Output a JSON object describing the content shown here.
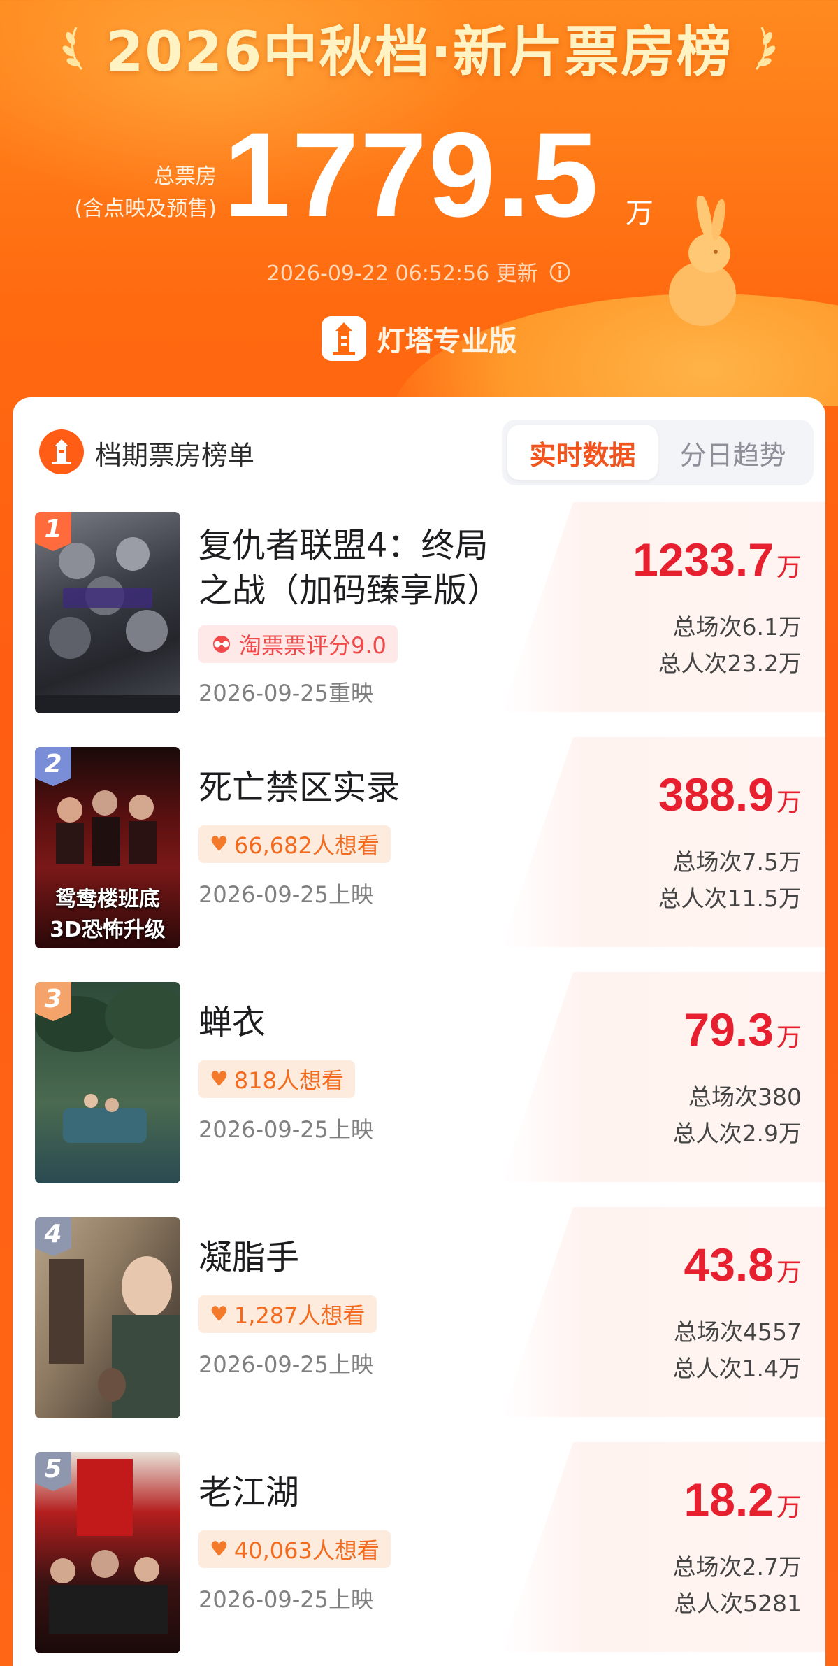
{
  "header": {
    "title": "2026中秋档·新片票房榜",
    "total_label_line1": "总票房",
    "total_label_line2": "(含点映及预售)",
    "total_value": "1779.5",
    "total_unit": "万",
    "updated": "2026-09-22 06:52:56 更新",
    "brand": "灯塔专业版"
  },
  "card": {
    "title": "档期票房榜单",
    "tabs": [
      "实时数据",
      "分日趋势"
    ],
    "active_tab": 0
  },
  "movies": [
    {
      "rank": "1",
      "name_line1": "复仇者联盟4：终局",
      "name_line2": "之战（加码臻享版）",
      "badge": "淘票票评分9.0",
      "badge_type": "rating",
      "release": "2026-09-25重映",
      "box_office": "1233.7",
      "unit": "万",
      "shows": "总场次6.1万",
      "admissions": "总人次23.2万"
    },
    {
      "rank": "2",
      "name_line1": "死亡禁区实录",
      "badge": "66,682人想看",
      "badge_type": "want",
      "poster_caption": "鸳鸯楼班底\n3D恐怖升级",
      "release": "2026-09-25上映",
      "box_office": "388.9",
      "unit": "万",
      "shows": "总场次7.5万",
      "admissions": "总人次11.5万"
    },
    {
      "rank": "3",
      "name_line1": "蝉衣",
      "badge": "818人想看",
      "badge_type": "want",
      "release": "2026-09-25上映",
      "box_office": "79.3",
      "unit": "万",
      "shows": "总场次380",
      "admissions": "总人次2.9万"
    },
    {
      "rank": "4",
      "name_line1": "凝脂手",
      "badge": "1,287人想看",
      "badge_type": "want",
      "release": "2026-09-25上映",
      "box_office": "43.8",
      "unit": "万",
      "shows": "总场次4557",
      "admissions": "总人次1.4万"
    },
    {
      "rank": "5",
      "name_line1": "老江湖",
      "badge": "40,063人想看",
      "badge_type": "want",
      "release": "2026-09-25上映",
      "box_office": "18.2",
      "unit": "万",
      "shows": "总场次2.7万",
      "admissions": "总人次5281"
    }
  ],
  "colors": {
    "accent": "#ff6a10",
    "box_office_red": "#e6202e",
    "tab_active": "#f2541e"
  }
}
